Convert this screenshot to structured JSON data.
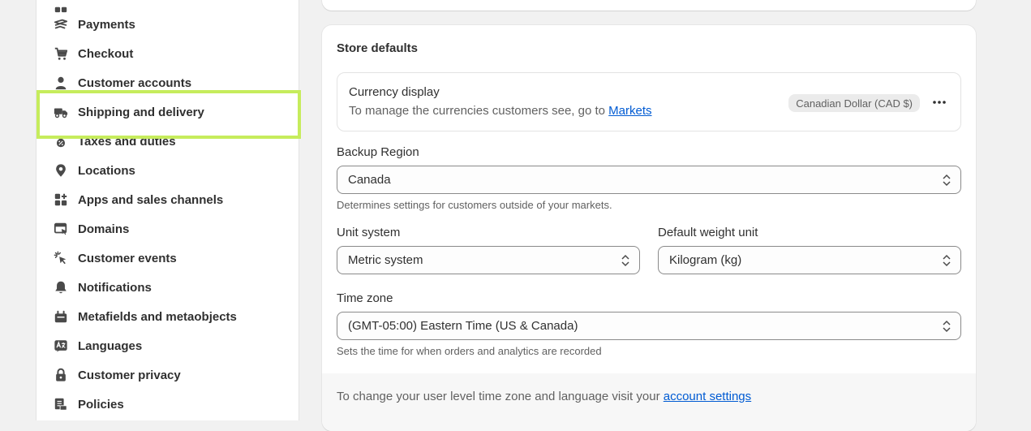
{
  "sidebar": {
    "items": [
      {
        "label": "Payments",
        "icon": "payments-icon"
      },
      {
        "label": "Checkout",
        "icon": "cart-icon"
      },
      {
        "label": "Customer accounts",
        "icon": "person-icon"
      },
      {
        "label": "Shipping and delivery",
        "icon": "truck-icon"
      },
      {
        "label": "Taxes and duties",
        "icon": "tax-icon"
      },
      {
        "label": "Locations",
        "icon": "location-pin-icon"
      },
      {
        "label": "Apps and sales channels",
        "icon": "apps-icon"
      },
      {
        "label": "Domains",
        "icon": "domains-icon"
      },
      {
        "label": "Customer events",
        "icon": "cursor-click-icon"
      },
      {
        "label": "Notifications",
        "icon": "bell-icon"
      },
      {
        "label": "Metafields and metaobjects",
        "icon": "metafields-icon"
      },
      {
        "label": "Languages",
        "icon": "languages-icon"
      },
      {
        "label": "Customer privacy",
        "icon": "lock-icon"
      },
      {
        "label": "Policies",
        "icon": "policies-icon"
      }
    ]
  },
  "store_defaults": {
    "title": "Store defaults",
    "currency": {
      "title": "Currency display",
      "desc_prefix": "To manage the currencies customers see, go to ",
      "desc_link": "Markets",
      "badge": "Canadian Dollar (CAD $)"
    },
    "backup_region": {
      "label": "Backup Region",
      "value": "Canada",
      "help": "Determines settings for customers outside of your markets."
    },
    "unit_system": {
      "label": "Unit system",
      "value": "Metric system"
    },
    "weight_unit": {
      "label": "Default weight unit",
      "value": "Kilogram (kg)"
    },
    "time_zone": {
      "label": "Time zone",
      "value": "(GMT-05:00) Eastern Time (US & Canada)",
      "help": "Sets the time for when orders and analytics are recorded"
    },
    "footer": {
      "prefix": "To change your user level time zone and language visit your ",
      "link": "account settings"
    }
  },
  "colors": {
    "highlight": "#c6ec5c",
    "link": "#005bd3"
  }
}
